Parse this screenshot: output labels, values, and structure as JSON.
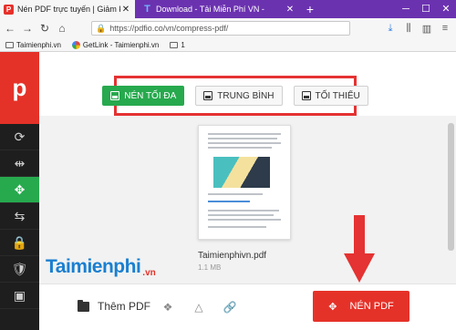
{
  "browser": {
    "tabs": [
      {
        "label": "Nén PDF trực tuyến | Giảm kích",
        "favicon": "P",
        "active": true
      },
      {
        "label": "Download - Tải Miễn Phí VN -",
        "favicon": "T",
        "active": false
      }
    ],
    "new_tab_glyph": "+",
    "url": "https://pdfio.co/vn/compress-pdf/",
    "bookmarks": [
      {
        "label": "Taimienphi.vn",
        "icon": "folder-icon"
      },
      {
        "label": "GetLink - Taimienphi.vn",
        "icon": "google-icon"
      },
      {
        "label": "1",
        "icon": "folder-icon"
      }
    ]
  },
  "sidebar": {
    "logo": "p",
    "items": [
      {
        "icon": "rotate-icon",
        "glyph": "⟳"
      },
      {
        "icon": "split-icon",
        "glyph": "⇹"
      },
      {
        "icon": "compress-icon",
        "glyph": "✥",
        "active": true
      },
      {
        "icon": "merge-icon",
        "glyph": "⇆"
      },
      {
        "icon": "lock-icon",
        "glyph": "🔒"
      },
      {
        "icon": "shield-icon",
        "glyph": "🛡"
      },
      {
        "icon": "image-icon",
        "glyph": "▣"
      }
    ]
  },
  "compression_modes": [
    {
      "label": "NÉN TỐI ĐA",
      "active": true
    },
    {
      "label": "TRUNG BÌNH",
      "active": false
    },
    {
      "label": "TỐI THIỂU",
      "active": false
    }
  ],
  "file": {
    "name": "Taimienphivn.pdf",
    "size": "1.1 MB"
  },
  "bottom": {
    "add_pdf_label": "Thêm PDF",
    "compress_label": "NÉN PDF"
  },
  "watermark": {
    "brand": "Taimienphi",
    "suffix": ".vn"
  },
  "colors": {
    "accent_red": "#e53229",
    "accent_green": "#27a94e",
    "tabbar_purple": "#6b32b0",
    "brand_blue": "#1a7fd0"
  }
}
